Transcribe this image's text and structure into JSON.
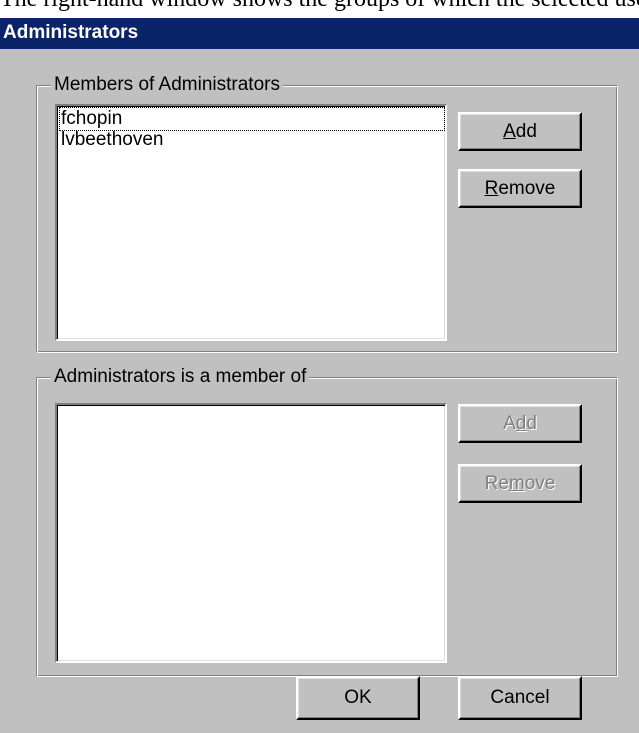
{
  "top_strip_text": "The right-hand window shows the groups of which the selected user is a member.",
  "window": {
    "title": "Administrators"
  },
  "members_group": {
    "label": "Members of Administrators",
    "items": [
      "fchopin",
      "lvbeethoven"
    ],
    "add_label": "Add",
    "add_mnemonic": "A",
    "remove_label": "Remove",
    "remove_mnemonic": "R"
  },
  "member_of_group": {
    "label": "Administrators is a member of",
    "items": [],
    "add_label": "Add",
    "add_mnemonic": "d",
    "remove_label": "Remove",
    "remove_mnemonic": "m"
  },
  "footer": {
    "ok_label": "OK",
    "cancel_label": "Cancel"
  }
}
